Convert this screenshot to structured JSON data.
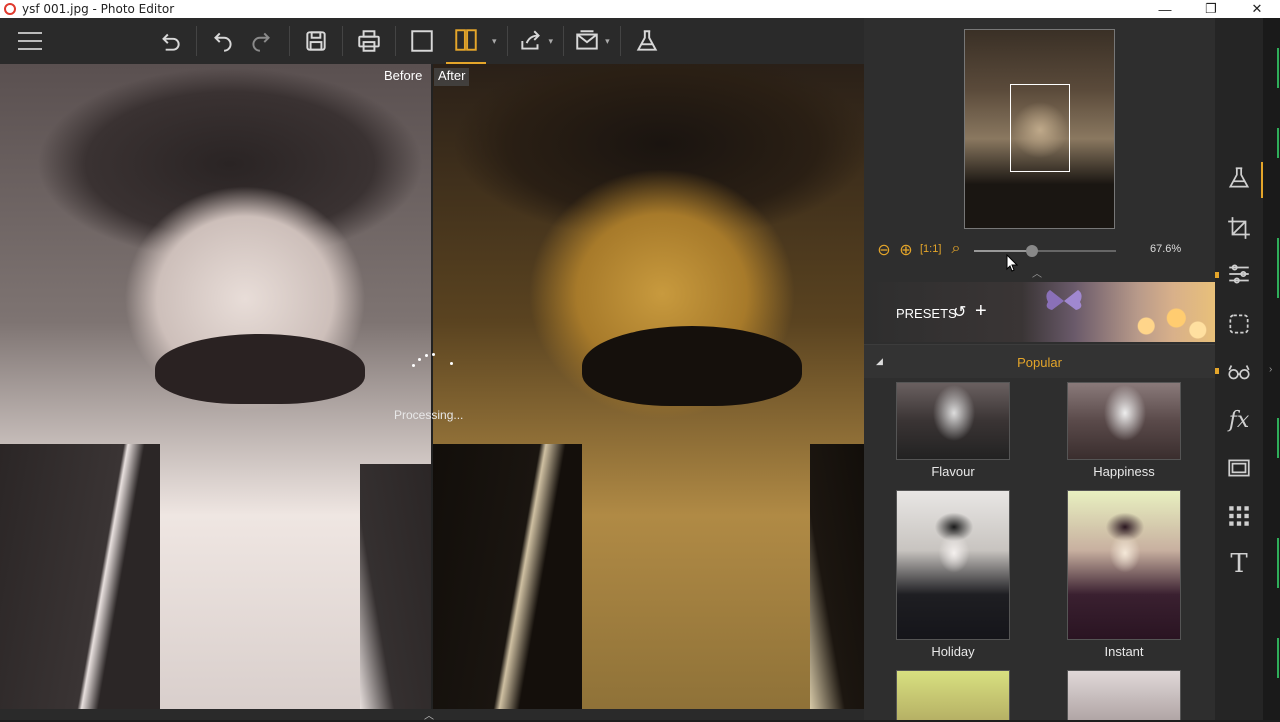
{
  "window": {
    "title": "ysf 001.jpg - Photo Editor",
    "minimize": "—",
    "restore": "❐",
    "close": "✕"
  },
  "toolbar": {
    "items": [
      "menu",
      "rotate-left",
      "undo",
      "redo",
      "save",
      "print",
      "single-view",
      "compare-view",
      "share",
      "email",
      "effects"
    ]
  },
  "canvas": {
    "before_label": "Before",
    "after_label": "After",
    "status": "Processing..."
  },
  "navigator": {
    "zoom_value": "67.6%",
    "zoom_fraction": 0.41
  },
  "presets": {
    "label": "PRESETS",
    "undo_glyph": "↺",
    "add_glyph": "+"
  },
  "category": {
    "toggle_glyph": "◢",
    "title": "Popular"
  },
  "preset_items": [
    {
      "name": "Flavour"
    },
    {
      "name": "Happiness"
    },
    {
      "name": "Holiday"
    },
    {
      "name": "Instant"
    }
  ],
  "sidebar": {
    "tools": [
      "lab-flask",
      "crop",
      "adjustments",
      "selection",
      "glasses",
      "fx",
      "frame",
      "texture",
      "text"
    ],
    "fx_label": "fx",
    "text_label": "T"
  },
  "colors": {
    "accent": "#e4a52a",
    "panel": "#2e2e2e",
    "toolbar": "#2a2a2a"
  }
}
